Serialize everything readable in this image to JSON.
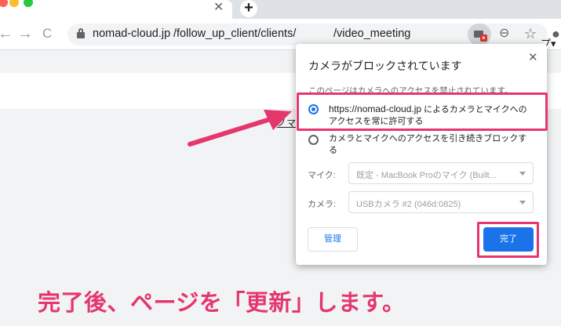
{
  "browser": {
    "tab_close_glyph": "✕",
    "new_tab_glyph": "+",
    "traffic_light_colors": [
      "#fe5f57",
      "#febc2e",
      "#28c840"
    ],
    "back_glyph": "←",
    "forward_glyph": "→",
    "reload_glyph": "C",
    "url_main": "nomad-cloud.jp",
    "url_path": "/follow_up_client/clients/",
    "url_tail": "/video_meeting",
    "zoom_glyph": "⊖",
    "star_glyph": "☆",
    "profile_glyph": "●"
  },
  "page": {
    "header_text": "プ▾",
    "link_text": "ノマ"
  },
  "popup": {
    "title": "カメラがブロックされています",
    "close_glyph": "✕",
    "subtitle": "このページはカメラへのアクセスを禁止されています。",
    "option_allow_host": "https://nomad-cloud.jp",
    "option_allow_rest": " によるカメラとマイクへの",
    "option_allow_line2": "アクセスを常に許可する",
    "option_block_line1": "カメラとマイクへのアクセスを引き続きブロックす",
    "option_block_line2": "る",
    "mic_label": "マイク:",
    "mic_value": "既定 - MacBook Proのマイク (Built...",
    "camera_label": "カメラ:",
    "camera_value": "USBカメラ #2 (046d:0825)",
    "manage_label": "管理",
    "done_label": "完了"
  },
  "annotation": {
    "caption": "完了後、ページを「更新」します。",
    "accent_color": "#e5366e"
  }
}
